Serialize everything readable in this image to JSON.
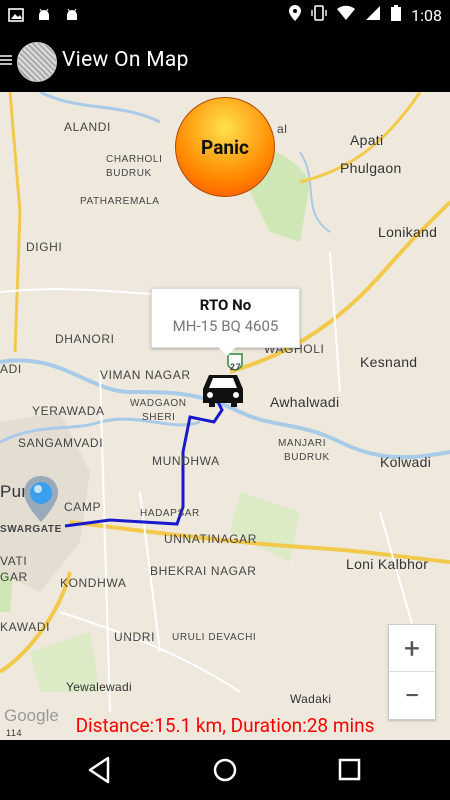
{
  "status_bar": {
    "time": "1:08"
  },
  "appbar": {
    "title": "View On Map"
  },
  "map": {
    "places": {
      "alandi": "ALANDI",
      "charholi": "CHARHOLI",
      "budruk": "BUDRUK",
      "apati": "Apati",
      "phulgaon": "Phulgaon",
      "patharemala": "PATHAREMALA",
      "lonikand": "Lonikand",
      "dighi": "DIGHI",
      "dhanori": "DHANORI",
      "wagholi": "WAGHOLI",
      "kesnand": "Kesnand",
      "viman_nagar": "VIMAN NAGAR",
      "awhalwadi": "Awhalwadi",
      "yerawada": "YERAWADA",
      "wadgaon": "WADGAON",
      "sheri": "SHERI",
      "sangamvadi": "SANGAMVADI",
      "mundhwa": "MUNDHWA",
      "manjari": "MANJARI",
      "budruk2": "BUDRUK",
      "kolwadi": "Kolwadi",
      "pune": "Pun",
      "camp": "CAMP",
      "hadapsar": "HADAPSAR",
      "swargate": "SWARGATE",
      "unnatinagar": "UNNATINAGAR",
      "loni_kalbhor": "Loni Kalbhor",
      "vati": "VATI",
      "gar": "GAR",
      "bhekrai": "BHEKRAI NAGAR",
      "kondhwa": "KONDHWA",
      "kawadi": "KAWADI",
      "undri": "UNDRI",
      "uruli": "URULI DEVACHI",
      "yewalewadi": "Yewalewadi",
      "wadaki": "Wadaki",
      "adi": "ADI",
      "al": "al"
    },
    "highway_shield": "27",
    "highway_shield2": "114",
    "google_logo": "Google"
  },
  "panic_button": {
    "label": "Panic"
  },
  "marker_info": {
    "title": "RTO No",
    "subtitle": "MH-15 BQ 4605"
  },
  "zoom": {
    "in": "+",
    "out": "−"
  },
  "route_summary": "Distance:15.1 km, Duration:28 mins"
}
